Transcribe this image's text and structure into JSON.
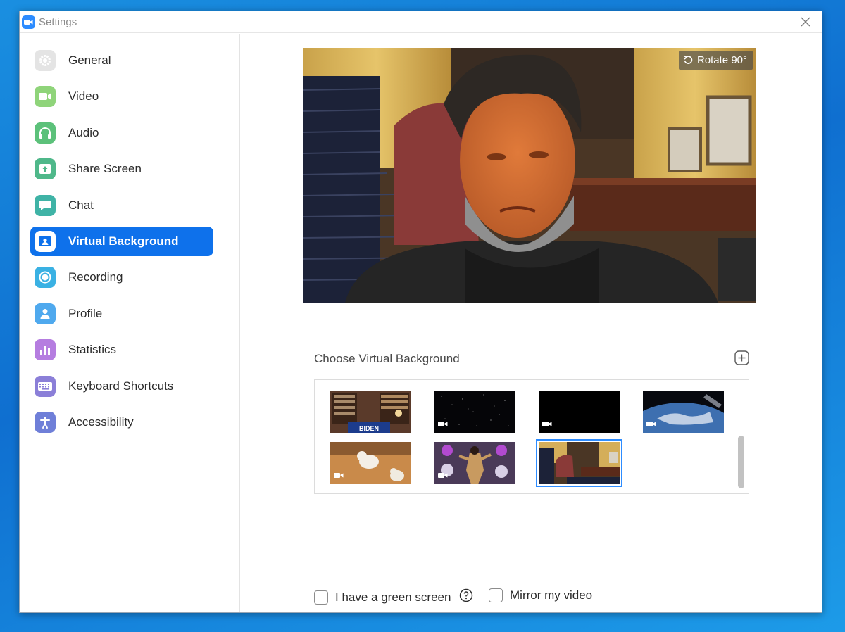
{
  "window": {
    "title": "Settings"
  },
  "sidebar": {
    "items": [
      {
        "label": "General",
        "icon": "gear-icon",
        "color": "#e4e4e4",
        "active": false
      },
      {
        "label": "Video",
        "icon": "video-camera-icon",
        "color": "#8fd47a",
        "active": false
      },
      {
        "label": "Audio",
        "icon": "headphones-icon",
        "color": "#5cc17a",
        "active": false
      },
      {
        "label": "Share Screen",
        "icon": "share-screen-icon",
        "color": "#4fb88a",
        "active": false
      },
      {
        "label": "Chat",
        "icon": "chat-bubble-icon",
        "color": "#3fb3a6",
        "active": false
      },
      {
        "label": "Virtual Background",
        "icon": "virtual-background-icon",
        "color": "#ffffff",
        "active": true
      },
      {
        "label": "Recording",
        "icon": "record-icon",
        "color": "#3ab1e3",
        "active": false
      },
      {
        "label": "Profile",
        "icon": "profile-icon",
        "color": "#4fa9ee",
        "active": false
      },
      {
        "label": "Statistics",
        "icon": "statistics-icon",
        "color": "#b57de0",
        "active": false
      },
      {
        "label": "Keyboard Shortcuts",
        "icon": "keyboard-icon",
        "color": "#8b7fd8",
        "active": false
      },
      {
        "label": "Accessibility",
        "icon": "accessibility-icon",
        "color": "#6f7fd8",
        "active": false
      }
    ]
  },
  "preview": {
    "rotate_label": "Rotate 90°"
  },
  "backgrounds": {
    "heading": "Choose Virtual Background",
    "thumbnails": [
      {
        "name": "library",
        "has_video": false,
        "selected": false
      },
      {
        "name": "starfield",
        "has_video": true,
        "selected": false
      },
      {
        "name": "black",
        "has_video": true,
        "selected": false
      },
      {
        "name": "earth",
        "has_video": true,
        "selected": false
      },
      {
        "name": "puppies",
        "has_video": true,
        "selected": false
      },
      {
        "name": "party",
        "has_video": true,
        "selected": false
      },
      {
        "name": "oval-office",
        "has_video": false,
        "selected": true
      }
    ],
    "thumb_text": "BIDEN"
  },
  "options": {
    "green_screen_label": "I have a green screen",
    "mirror_label": "Mirror my video",
    "green_screen_checked": false,
    "mirror_checked": false
  },
  "colors": {
    "accent": "#0e71eb",
    "zoom_blue": "#2d8cff"
  }
}
